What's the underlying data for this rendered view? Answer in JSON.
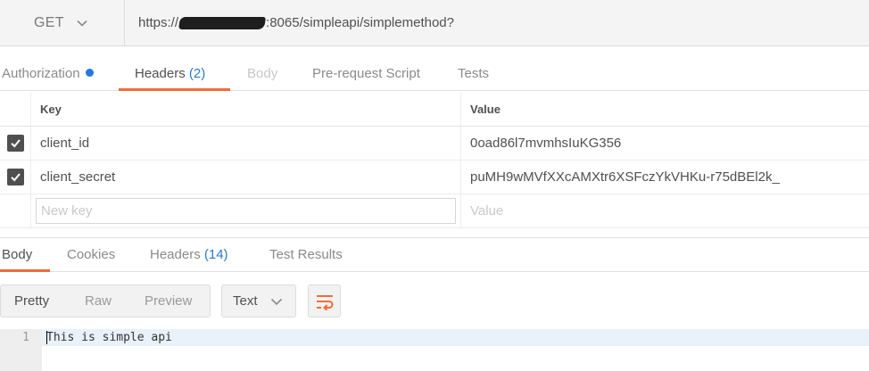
{
  "request": {
    "method": "GET",
    "url_prefix": "https://",
    "url_suffix": ":8065/simpleapi/simplemethod?"
  },
  "request_tabs": [
    {
      "label": "Authorization",
      "badge": "",
      "state": "normal",
      "has_dot": true
    },
    {
      "label": "Headers",
      "badge": "(2)",
      "state": "active"
    },
    {
      "label": "Body",
      "badge": "",
      "state": "disabled"
    },
    {
      "label": "Pre-request Script",
      "badge": "",
      "state": "normal"
    },
    {
      "label": "Tests",
      "badge": "",
      "state": "normal"
    }
  ],
  "headers_table": {
    "key_header": "Key",
    "value_header": "Value",
    "rows": [
      {
        "key": "client_id",
        "value": "0oad86l7mvmhsIuKG356",
        "checked": true
      },
      {
        "key": "client_secret",
        "value": "puMH9wMVfXXcAMXtr6XSFczYkVHKu-r75dBEl2k_",
        "checked": true
      }
    ],
    "new_key_placeholder": "New key",
    "new_value_placeholder": "Value"
  },
  "response_tabs": [
    {
      "label": "Body",
      "badge": "",
      "state": "active"
    },
    {
      "label": "Cookies",
      "badge": "",
      "state": "normal"
    },
    {
      "label": "Headers",
      "badge": "(14)",
      "state": "normal"
    },
    {
      "label": "Test Results",
      "badge": "",
      "state": "normal"
    }
  ],
  "response_toolbar": {
    "view_modes": [
      "Pretty",
      "Raw",
      "Preview"
    ],
    "active_view": "Pretty",
    "format": "Text",
    "wrap_icon": "wrap-lines-icon"
  },
  "response_body": {
    "lines": [
      {
        "number": "1",
        "text": "This is simple api"
      }
    ]
  },
  "colors": {
    "accent": "#f26b3a",
    "badge_blue": "#2a7ac7",
    "dot_blue": "#1f7ae0"
  }
}
